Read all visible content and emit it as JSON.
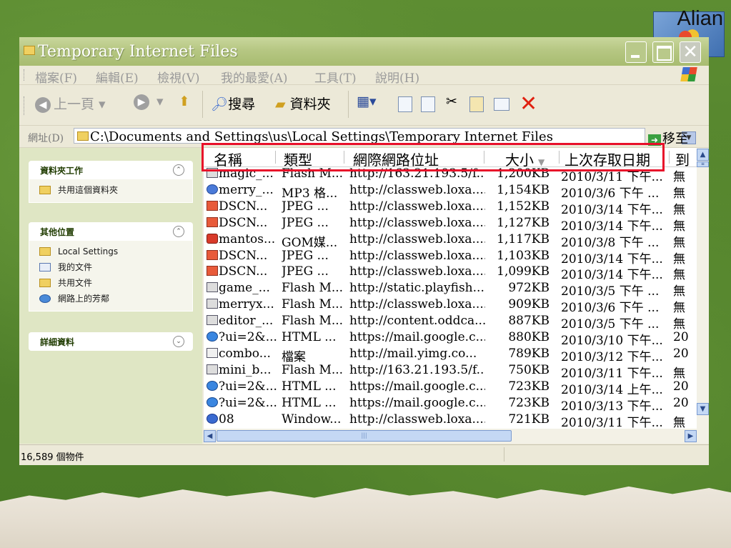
{
  "logo": {
    "text": "Alian"
  },
  "window": {
    "title": "Temporary Internet Files",
    "menu": [
      "檔案(F)",
      "編輯(E)",
      "檢視(V)",
      "我的最愛(A)",
      "工具(T)",
      "說明(H)"
    ],
    "toolbar": {
      "back_label": "上一頁",
      "search_label": "搜尋",
      "folders_label": "資料夾"
    },
    "address": {
      "label": "網址(D)",
      "value": "C:\\Documents and Settings\\us\\Local Settings\\Temporary Internet Files",
      "go_label": "移至"
    },
    "taskpane": {
      "folder_tasks": {
        "title": "資料夾工作",
        "items": [
          "共用這個資料夾"
        ]
      },
      "other_places": {
        "title": "其他位置",
        "items": [
          "Local Settings",
          "我的文件",
          "共用文件",
          "網路上的芳鄰"
        ]
      },
      "details": {
        "title": "詳細資料"
      }
    },
    "columns": [
      "名稱",
      "類型",
      "網際網路位址",
      "大小",
      "上次存取日期",
      "到"
    ],
    "files": [
      {
        "icon": "flash-icon",
        "name": "magic_...",
        "type": "Flash M...",
        "address": "http://163.21.193.5/f...",
        "size": "1,200KB",
        "date": "2010/3/11 下午...",
        "expires": "無"
      },
      {
        "icon": "mp3-icon",
        "name": "merry_...",
        "type": "MP3 格...",
        "address": "http://classweb.loxa....",
        "size": "1,154KB",
        "date": "2010/3/6 下午 ...",
        "expires": "無"
      },
      {
        "icon": "jpeg-icon",
        "name": "DSCN...",
        "type": "JPEG ...",
        "address": "http://classweb.loxa....",
        "size": "1,152KB",
        "date": "2010/3/14 下午...",
        "expires": "無"
      },
      {
        "icon": "jpeg-icon",
        "name": "DSCN...",
        "type": "JPEG ...",
        "address": "http://classweb.loxa....",
        "size": "1,127KB",
        "date": "2010/3/14 下午...",
        "expires": "無"
      },
      {
        "icon": "gom-icon",
        "name": "mantos...",
        "type": "GOM媒...",
        "address": "http://classweb.loxa....",
        "size": "1,117KB",
        "date": "2010/3/8 下午 ...",
        "expires": "無"
      },
      {
        "icon": "jpeg-icon",
        "name": "DSCN...",
        "type": "JPEG ...",
        "address": "http://classweb.loxa....",
        "size": "1,103KB",
        "date": "2010/3/14 下午...",
        "expires": "無"
      },
      {
        "icon": "jpeg-icon",
        "name": "DSCN...",
        "type": "JPEG ...",
        "address": "http://classweb.loxa....",
        "size": "1,099KB",
        "date": "2010/3/14 下午...",
        "expires": "無"
      },
      {
        "icon": "flash-icon",
        "name": "game_...",
        "type": "Flash M...",
        "address": "http://static.playfish....",
        "size": "972KB",
        "date": "2010/3/5 下午 ...",
        "expires": "無"
      },
      {
        "icon": "flash-icon",
        "name": "merryx...",
        "type": "Flash M...",
        "address": "http://classweb.loxa....",
        "size": "909KB",
        "date": "2010/3/6 下午 ...",
        "expires": "無"
      },
      {
        "icon": "flash-icon",
        "name": "editor_...",
        "type": "Flash M...",
        "address": "http://content.oddca...",
        "size": "887KB",
        "date": "2010/3/5 下午 ...",
        "expires": "無"
      },
      {
        "icon": "html-icon",
        "name": "?ui=2&...",
        "type": "HTML ...",
        "address": "https://mail.google.c...",
        "size": "880KB",
        "date": "2010/3/10 下午...",
        "expires": "20"
      },
      {
        "icon": "file-icon",
        "name": "combo...",
        "type": "檔案",
        "address": "http://mail.yimg.co...",
        "size": "789KB",
        "date": "2010/3/12 下午...",
        "expires": "20"
      },
      {
        "icon": "flash-icon",
        "name": "mini_b...",
        "type": "Flash M...",
        "address": "http://163.21.193.5/f...",
        "size": "750KB",
        "date": "2010/3/11 下午...",
        "expires": "無"
      },
      {
        "icon": "html-icon",
        "name": "?ui=2&...",
        "type": "HTML ...",
        "address": "https://mail.google.c...",
        "size": "723KB",
        "date": "2010/3/14 上午...",
        "expires": "20"
      },
      {
        "icon": "html-icon",
        "name": "?ui=2&...",
        "type": "HTML ...",
        "address": "https://mail.google.c...",
        "size": "723KB",
        "date": "2010/3/13 下午...",
        "expires": "20"
      },
      {
        "icon": "windows-media-icon",
        "name": "08",
        "type": "Window...",
        "address": "http://classweb.loxa....",
        "size": "721KB",
        "date": "2010/3/11 下午...",
        "expires": "無"
      }
    ],
    "status": "16,589 個物件"
  },
  "colors": {
    "highlight": "#e8102a",
    "task_pane": "#dfe6c4",
    "title_bar": "#b6c783"
  }
}
